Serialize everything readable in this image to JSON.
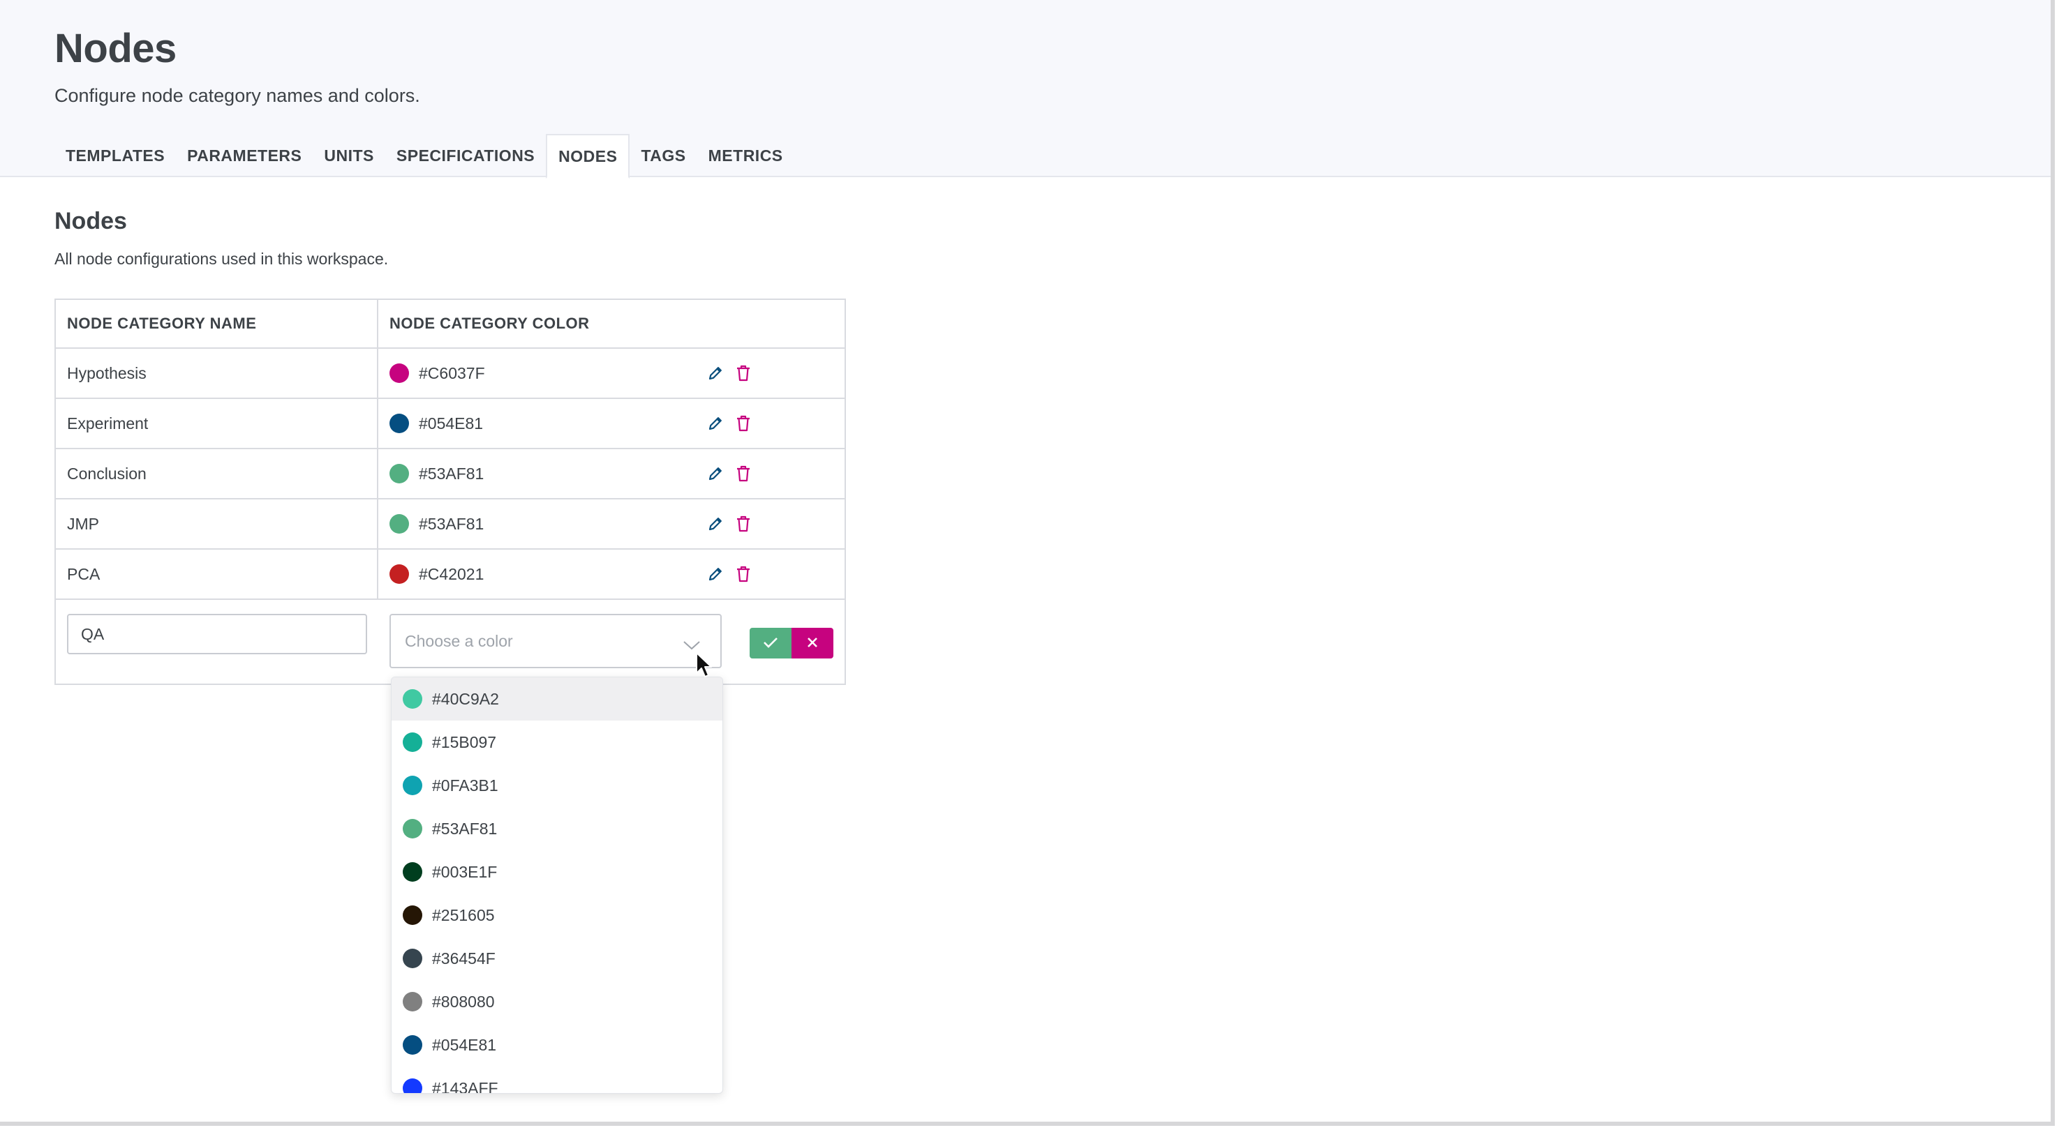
{
  "header": {
    "title": "Nodes",
    "subtitle": "Configure node category names and colors."
  },
  "tabs": [
    {
      "label": "TEMPLATES"
    },
    {
      "label": "PARAMETERS"
    },
    {
      "label": "UNITS"
    },
    {
      "label": "SPECIFICATIONS"
    },
    {
      "label": "NODES",
      "active": true
    },
    {
      "label": "TAGS"
    },
    {
      "label": "METRICS"
    }
  ],
  "section": {
    "title": "Nodes",
    "description": "All node configurations used in this workspace."
  },
  "table": {
    "columns": [
      "NODE CATEGORY NAME",
      "NODE CATEGORY COLOR"
    ],
    "rows": [
      {
        "name": "Hypothesis",
        "color": "#C6037F"
      },
      {
        "name": "Experiment",
        "color": "#054E81"
      },
      {
        "name": "Conclusion",
        "color": "#53AF81"
      },
      {
        "name": "JMP",
        "color": "#53AF81"
      },
      {
        "name": "PCA",
        "color": "#C42021"
      }
    ]
  },
  "new_row": {
    "name_value": "QA",
    "color_placeholder": "Choose a color"
  },
  "dropdown": {
    "options": [
      "#40C9A2",
      "#15B097",
      "#0FA3B1",
      "#53AF81",
      "#003E1F",
      "#251605",
      "#36454F",
      "#808080",
      "#054E81",
      "#143AFF"
    ],
    "highlighted": "#40C9A2"
  },
  "colors": {
    "confirm": "#53AF81",
    "cancel": "#C6037F",
    "edit_icon": "#0B4F7D",
    "delete_icon": "#C6037F"
  },
  "icons": {
    "edit": "pencil-icon",
    "delete": "trash-icon",
    "confirm": "check-icon",
    "cancel": "close-icon",
    "select": "chevron-down-icon",
    "cursor": "mouse-pointer-icon"
  }
}
